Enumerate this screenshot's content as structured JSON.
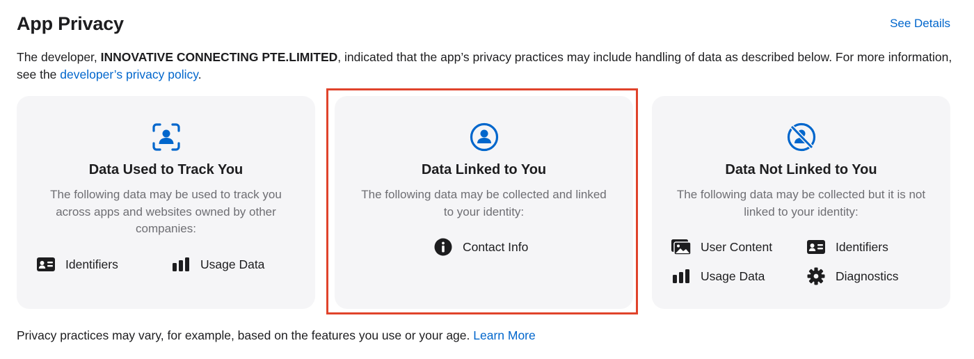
{
  "header": {
    "title": "App Privacy",
    "see_details": "See Details"
  },
  "intro": {
    "prefix": "The developer, ",
    "developer": "INNOVATIVE CONNECTING PTE.LIMITED",
    "middle": ", indicated that the app’s privacy practices may include handling of data as described below. For more information, see the ",
    "policy_link": "developer’s privacy policy",
    "suffix": "."
  },
  "cards": [
    {
      "title": "Data Used to Track You",
      "description": "The following data may be used to track you across apps and websites owned by other companies:",
      "icon": "person-tracking-icon",
      "items": [
        {
          "label": "Identifiers",
          "icon": "id-card-icon"
        },
        {
          "label": "Usage Data",
          "icon": "bar-chart-icon"
        }
      ]
    },
    {
      "title": "Data Linked to You",
      "description": "The following data may be collected and linked to your identity:",
      "icon": "person-circle-icon",
      "items": [
        {
          "label": "Contact Info",
          "icon": "info-circle-icon"
        }
      ]
    },
    {
      "title": "Data Not Linked to You",
      "description": "The following data may be collected but it is not linked to your identity:",
      "icon": "person-slash-icon",
      "items": [
        {
          "label": "User Content",
          "icon": "photos-icon"
        },
        {
          "label": "Identifiers",
          "icon": "id-card-icon"
        },
        {
          "label": "Usage Data",
          "icon": "bar-chart-icon"
        },
        {
          "label": "Diagnostics",
          "icon": "gear-icon"
        }
      ]
    }
  ],
  "footer": {
    "text": "Privacy practices may vary, for example, based on the features you use or your age. ",
    "learn_more": "Learn More"
  },
  "colors": {
    "accent": "#0066cc",
    "highlight": "#e0432b",
    "card_bg": "#f5f5f7",
    "secondary_text": "#6e6e73"
  }
}
